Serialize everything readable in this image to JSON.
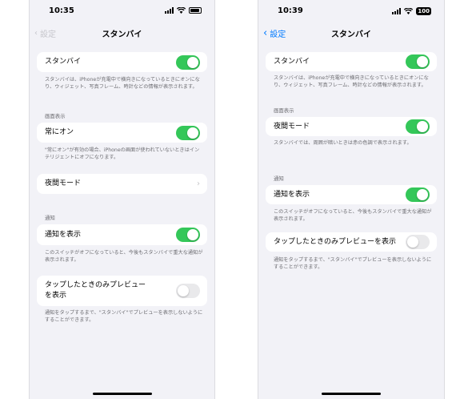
{
  "left": {
    "time": "10:35",
    "back_label": "設定",
    "title": "スタンバイ",
    "standby_label": "スタンバイ",
    "standby_desc": "スタンバイは、iPhoneが充電中で横向きになっているときにオンになり、ウィジェット、写真フレーム、時計などの情報が表示されます。",
    "display_header": "画面表示",
    "always_on_label": "常にオン",
    "always_on_desc": "\"常にオン\"が有効の場合、iPhoneの画面が使われていないときはインテリジェントにオフになります。",
    "night_mode_label": "夜間モード",
    "notif_header": "通知",
    "show_notif_label": "通知を表示",
    "show_notif_desc": "このスイッチがオフになっていると、今後もスタンバイで重大な通知が表示されます。",
    "tap_preview_label": "タップしたときのみプレビューを表示",
    "tap_preview_desc": "通知をタップするまで、\"スタンバイ\"でプレビューを表示しないようにすることができます。"
  },
  "right": {
    "time": "10:39",
    "battery": "100",
    "back_label": "設定",
    "title": "スタンバイ",
    "standby_label": "スタンバイ",
    "standby_desc": "スタンバイは、iPhoneが充電中で横向きになっているときにオンになり、ウィジェット、写真フレーム、時計などの情報が表示されます。",
    "display_header": "画面表示",
    "night_mode_label": "夜間モード",
    "night_mode_desc": "スタンバイでは、周囲が暗いときは赤の色調で表示されます。",
    "notif_header": "通知",
    "show_notif_label": "通知を表示",
    "show_notif_desc": "このスイッチがオフになっていると、今後もスタンバイで重大な通知が表示されます。",
    "tap_preview_label": "タップしたときのみプレビューを表示",
    "tap_preview_desc": "通知をタップするまで、\"スタンバイ\"でプレビューを表示しないようにすることができます。"
  },
  "colors": {
    "toggle_on": "#34c759",
    "toggle_off": "#e9e9eb",
    "link": "#007aff",
    "background": "#f2f2f7"
  }
}
